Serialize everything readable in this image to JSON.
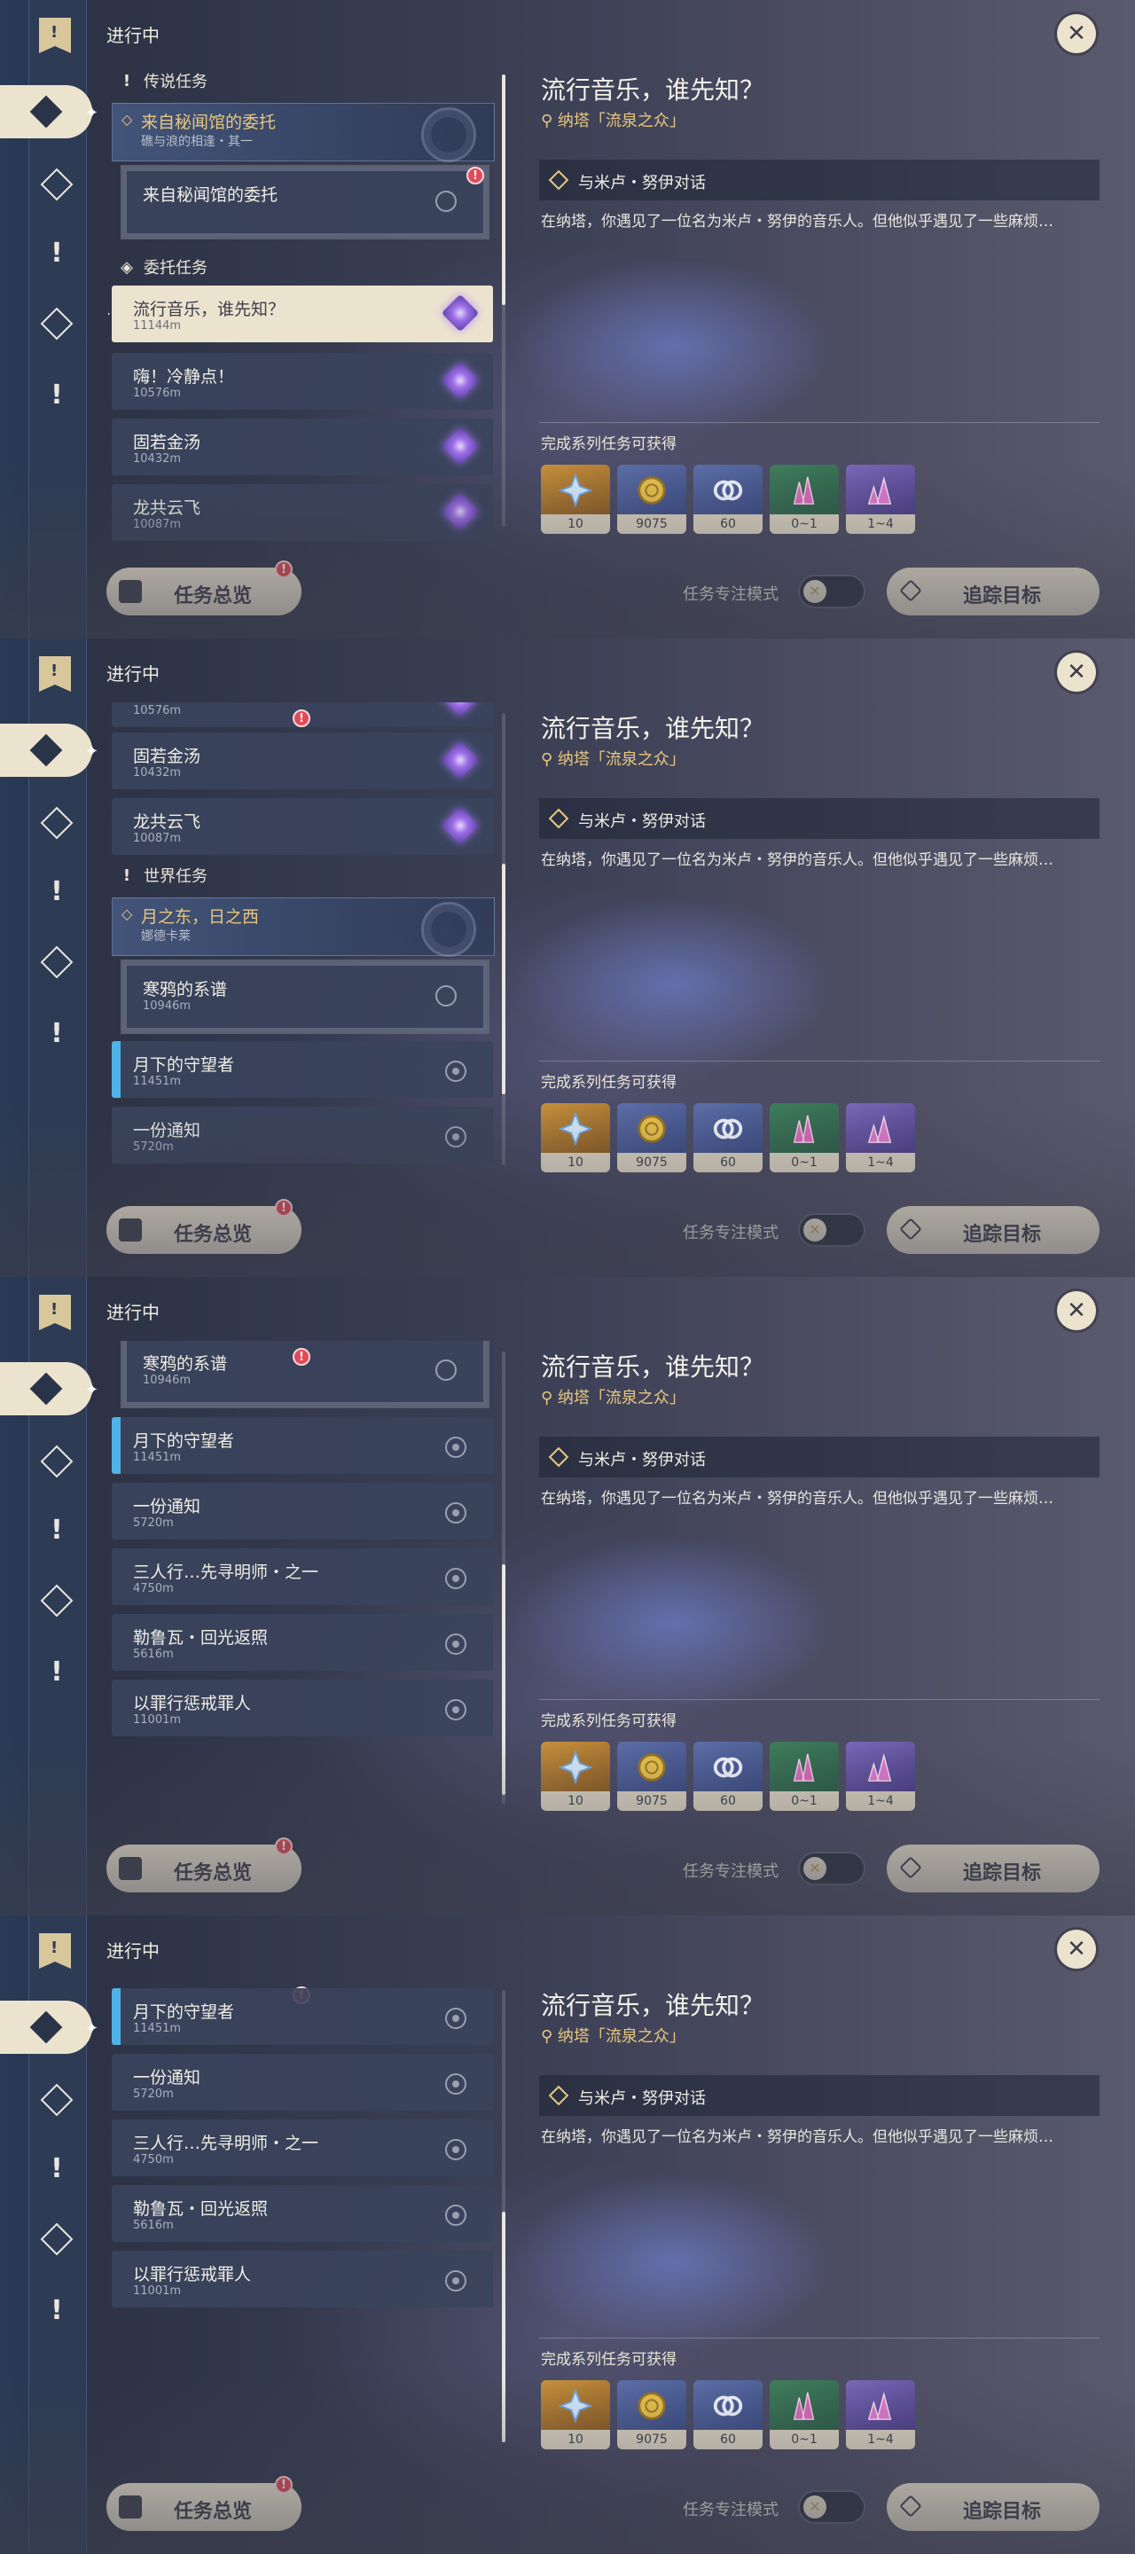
{
  "status_label": "进行中",
  "sections": {
    "legend": "传说任务",
    "commission": "委托任务",
    "world": "世界任务"
  },
  "quests": {
    "legend_main": {
      "title": "来自秘闻馆的委托",
      "subtitle": "礁与浪的相逢・其一"
    },
    "legend_sub": {
      "title": "来自秘闻馆的委托"
    },
    "music": {
      "title": "流行音乐，谁先知？",
      "distance": "11144m"
    },
    "calm": {
      "title": "嗨！冷静点！",
      "distance": "10576m"
    },
    "soup": {
      "title": "固若金汤",
      "distance": "10432m"
    },
    "dragon": {
      "title": "龙共云飞",
      "distance": "10087m"
    },
    "world_main": {
      "title": "月之东，日之西",
      "subtitle": "娜德卡莱"
    },
    "raven": {
      "title": "寒鸦的系谱",
      "distance": "10946m"
    },
    "moon": {
      "title": "月下的守望者",
      "distance": "11451m"
    },
    "notice": {
      "title": "一份通知",
      "distance": "5720m"
    },
    "three": {
      "title": "三人行…先寻明师・之一",
      "distance": "4750m"
    },
    "lerou": {
      "title": "勒鲁瓦・回光返照",
      "distance": "5616m"
    },
    "sin": {
      "title": "以罪行惩戒罪人",
      "distance": "11001m"
    }
  },
  "detail": {
    "title": "流行音乐，谁先知？",
    "location": "纳塔「流泉之众」",
    "objective": "与米卢・努伊对话",
    "description": "在纳塔，你遇见了一位名为米卢・努伊的音乐人。但他似乎遇见了一些麻烦…",
    "rewards_label": "完成系列任务可获得",
    "rewards": [
      {
        "icon": "adventure-exp-icon",
        "count": "10",
        "tone": "gold"
      },
      {
        "icon": "mora-coin-icon",
        "count": "9075",
        "tone": "blue"
      },
      {
        "icon": "companionship-exp-icon",
        "count": "60",
        "tone": "blue"
      },
      {
        "icon": "crystal-ore-icon",
        "count": "0~1",
        "tone": "green"
      },
      {
        "icon": "crystal-chunk-icon",
        "count": "1~4",
        "tone": "purple"
      }
    ]
  },
  "buttons": {
    "overview": "任务总览",
    "focus_mode": "任务专注模式",
    "track": "追踪目标",
    "alert_mark": "!"
  },
  "nav": {
    "bookmark_mark": "!",
    "excl_mark": "!"
  }
}
